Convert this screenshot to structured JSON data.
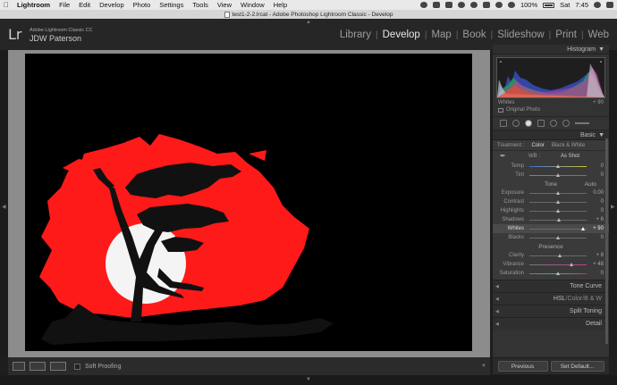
{
  "menubar": {
    "app": "Lightroom",
    "items": [
      "File",
      "Edit",
      "Develop",
      "Photo",
      "Settings",
      "Tools",
      "View",
      "Window",
      "Help"
    ],
    "battery": "100%",
    "day": "Sat",
    "time": "7:45"
  },
  "window": {
    "title": "test1-2-2.lrcat - Adobe Photoshop Lightroom Classic - Develop"
  },
  "identity": {
    "logo": "Lr",
    "product": "Adobe Lightroom Classic CC",
    "user": "JDW Paterson"
  },
  "modules": [
    "Library",
    "Develop",
    "Map",
    "Book",
    "Slideshow",
    "Print",
    "Web"
  ],
  "active_module": "Develop",
  "toolbar": {
    "soft_proofing": "Soft Proofing"
  },
  "right_panel": {
    "histogram": {
      "title": "Histogram",
      "label": "Whites",
      "value": "+ 90",
      "original_photo": "Original Photo"
    },
    "basic": {
      "title": "Basic",
      "treatment_label": "Treatment :",
      "treatment_color": "Color",
      "treatment_bw": "Black & White",
      "wb_label": "WB :",
      "wb_value": "As Shot",
      "temp": {
        "label": "Temp",
        "value": "0",
        "level": 0.5
      },
      "tint": {
        "label": "Tint",
        "value": "0",
        "level": 0.5
      },
      "tone_label": "Tone",
      "auto_label": "Auto",
      "exposure": {
        "label": "Exposure",
        "value": "0.00",
        "level": 0.5
      },
      "contrast": {
        "label": "Contrast",
        "value": "0",
        "level": 0.5
      },
      "highlights": {
        "label": "Highlights",
        "value": "0",
        "level": 0.5
      },
      "shadows": {
        "label": "Shadows",
        "value": "+ 6",
        "level": 0.53
      },
      "whites": {
        "label": "Whites",
        "value": "+ 90",
        "level": 0.95
      },
      "blacks": {
        "label": "Blacks",
        "value": "0",
        "level": 0.5
      },
      "presence_label": "Presence",
      "clarity": {
        "label": "Clarity",
        "value": "+ 8",
        "level": 0.54
      },
      "vibrance": {
        "label": "Vibrance",
        "value": "+ 48",
        "level": 0.74
      },
      "saturation": {
        "label": "Saturation",
        "value": "0",
        "level": 0.5
      }
    },
    "collapsed": {
      "tone_curve": "Tone Curve",
      "hsl": "HSL",
      "color": "Color",
      "bw": "B & W",
      "split_toning": "Split Toning",
      "detail": "Detail"
    },
    "buttons": {
      "previous": "Previous",
      "set_default": "Set Default..."
    }
  },
  "colors": {
    "photo_red": "#ff1a1a",
    "background": "#1e1e1e",
    "panel": "#333333"
  }
}
